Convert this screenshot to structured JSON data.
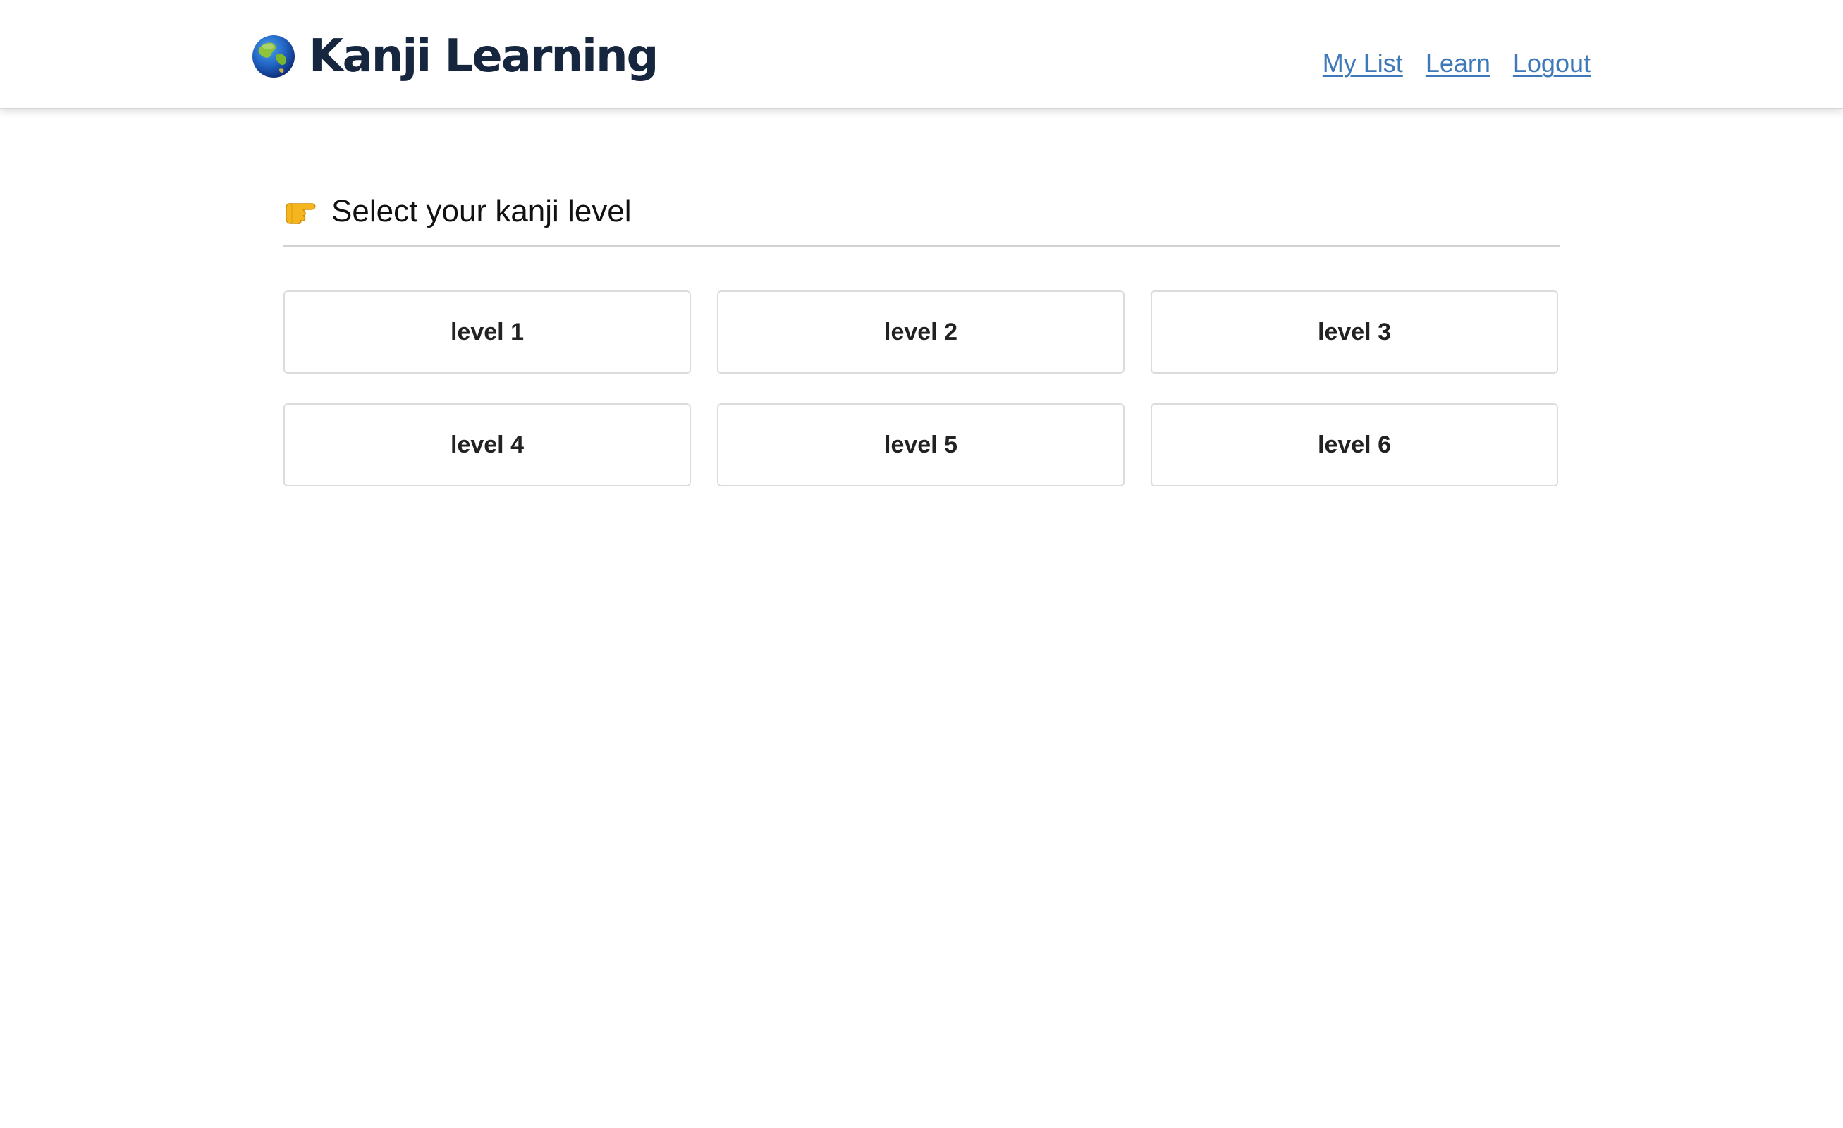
{
  "header": {
    "title": "Kanji Learning",
    "logo_icon": "globe-asia-icon",
    "nav": [
      {
        "label": "My List"
      },
      {
        "label": "Learn"
      },
      {
        "label": "Logout"
      }
    ]
  },
  "main": {
    "heading_icon": "pointing-right-hand-icon",
    "heading": "Select your kanji level",
    "levels": [
      {
        "label": "level 1"
      },
      {
        "label": "level 2"
      },
      {
        "label": "level 3"
      },
      {
        "label": "level 4"
      },
      {
        "label": "level 5"
      },
      {
        "label": "level 6"
      }
    ]
  },
  "colors": {
    "brand_text": "#16263e",
    "link": "#3d78b8",
    "card_border": "#dcdcdc",
    "divider": "#d2d2d2"
  }
}
